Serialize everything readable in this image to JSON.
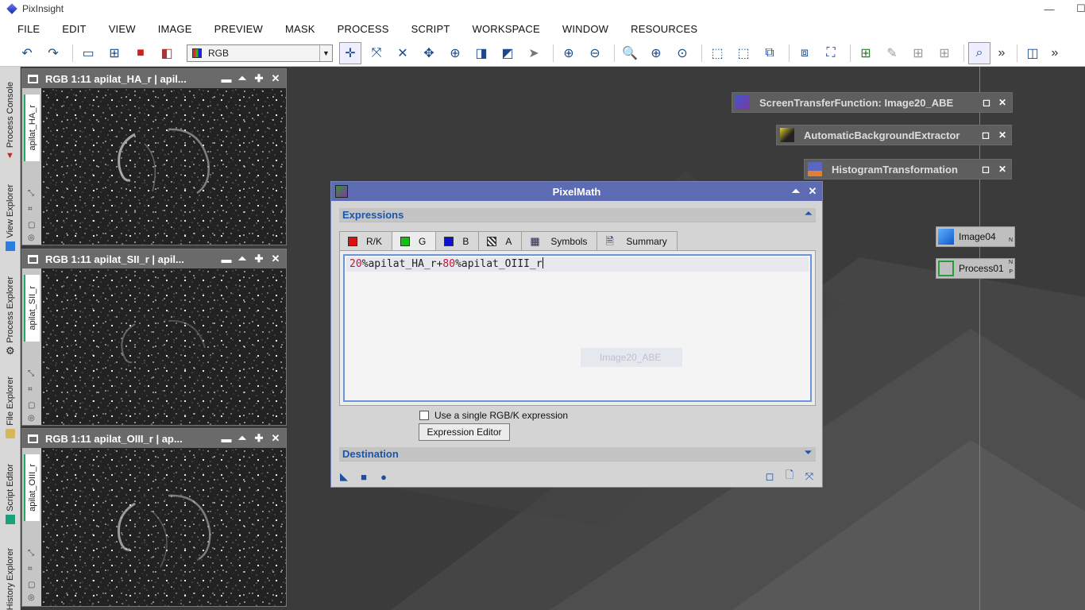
{
  "app": {
    "title": "PixInsight",
    "minimize": "—",
    "maximize": "☐"
  },
  "menu": [
    "FILE",
    "EDIT",
    "VIEW",
    "IMAGE",
    "PREVIEW",
    "MASK",
    "PROCESS",
    "SCRIPT",
    "WORKSPACE",
    "WINDOW",
    "RESOURCES"
  ],
  "toolbar": {
    "color_space": "RGB",
    "overflow": "»"
  },
  "side_tabs": [
    "Process Console",
    "View Explorer",
    "Process Explorer",
    "File Explorer",
    "Script Editor",
    "History Explorer"
  ],
  "image_windows": [
    {
      "title": "RGB 1:11 apilat_HA_r | apil...",
      "view_id": "apilat_HA_r"
    },
    {
      "title": "RGB 1:11 apilat_SII_r | apil...",
      "view_id": "apilat_SII_r"
    },
    {
      "title": "RGB 1:11 apilat_OIII_r | ap...",
      "view_id": "apilat_OIII_r"
    }
  ],
  "iconized_windows": [
    {
      "title": "ScreenTransferFunction: Image20_ABE",
      "icon": "stf-icon"
    },
    {
      "title": "AutomaticBackgroundExtractor",
      "icon": "abe-icon"
    },
    {
      "title": "HistogramTransformation",
      "icon": "histogram-icon"
    }
  ],
  "process_icons": [
    {
      "label": "Image04",
      "badge": "N",
      "icon": "image-cube-icon"
    },
    {
      "label": "Process01",
      "badge": "N",
      "badge2": "P",
      "icon": "crop-icon"
    }
  ],
  "pixelmath": {
    "title": "PixelMath",
    "expressions_label": "Expressions",
    "tabs": [
      {
        "label": "R/K",
        "color": "#e01010"
      },
      {
        "label": "G",
        "color": "#10c010"
      },
      {
        "label": "B",
        "color": "#1010d0"
      },
      {
        "label": "A",
        "icon": "alpha-icon"
      },
      {
        "label": "Symbols",
        "icon": "table-icon"
      },
      {
        "label": "Summary",
        "icon": "document-icon"
      }
    ],
    "expression": {
      "n1": "20",
      "p1": "%apilat_HA_r+",
      "n2": "80",
      "p2": "%apilat_OIII_r"
    },
    "ghost_label": "Image20_ABE",
    "single_expression_label": "Use a single RGB/K expression",
    "single_expression_checked": false,
    "expression_editor_label": "Expression Editor",
    "destination_label": "Destination"
  }
}
